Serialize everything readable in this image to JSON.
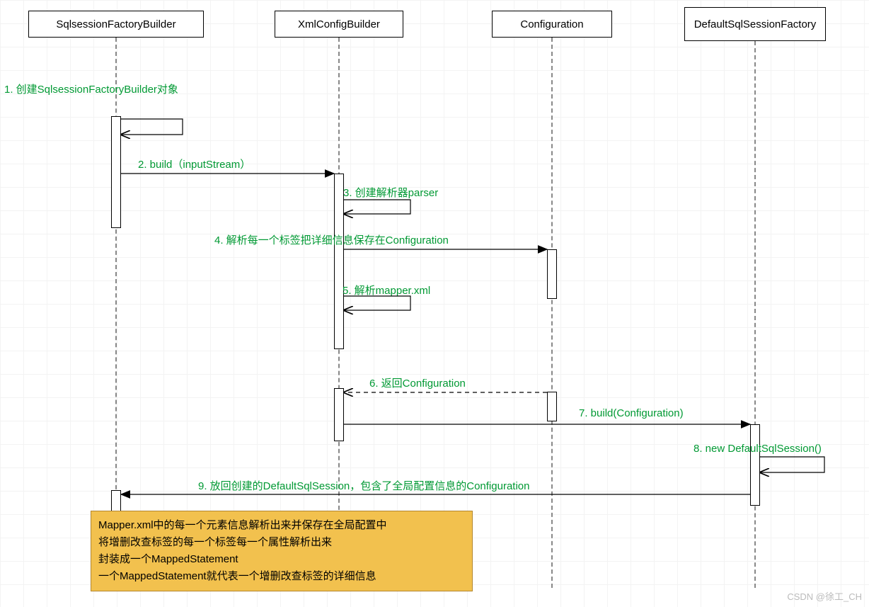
{
  "participants": {
    "p1": "SqlsessionFactoryBuilder",
    "p2": "XmlConfigBuilder",
    "p3": "Configuration",
    "p4": "DefaultSqlSessionFactory"
  },
  "messages": {
    "m1": "1. 创建SqlsessionFactoryBuilder对象",
    "m2": "2. build（inputStream）",
    "m3": "3. 创建解析器parser",
    "m4": "4. 解析每一个标签把详细信息保存在Configuration",
    "m5": "5. 解析mapper.xml",
    "m6": "6. 返回Configuration",
    "m7": "7. build(Configuration)",
    "m8": "8. new DefaultSqlSession()",
    "m9": "9. 放回创建的DefaultSqlSession，包含了全局配置信息的Configuration"
  },
  "note": {
    "l1": "Mapper.xml中的每一个元素信息解析出来并保存在全局配置中",
    "l2": "将增删改查标签的每一个标签每一个属性解析出来",
    "l3": "封装成一个MappedStatement",
    "l4": "一个MappedStatement就代表一个增删改查标签的详细信息"
  },
  "watermark": "CSDN @徐工_CH"
}
